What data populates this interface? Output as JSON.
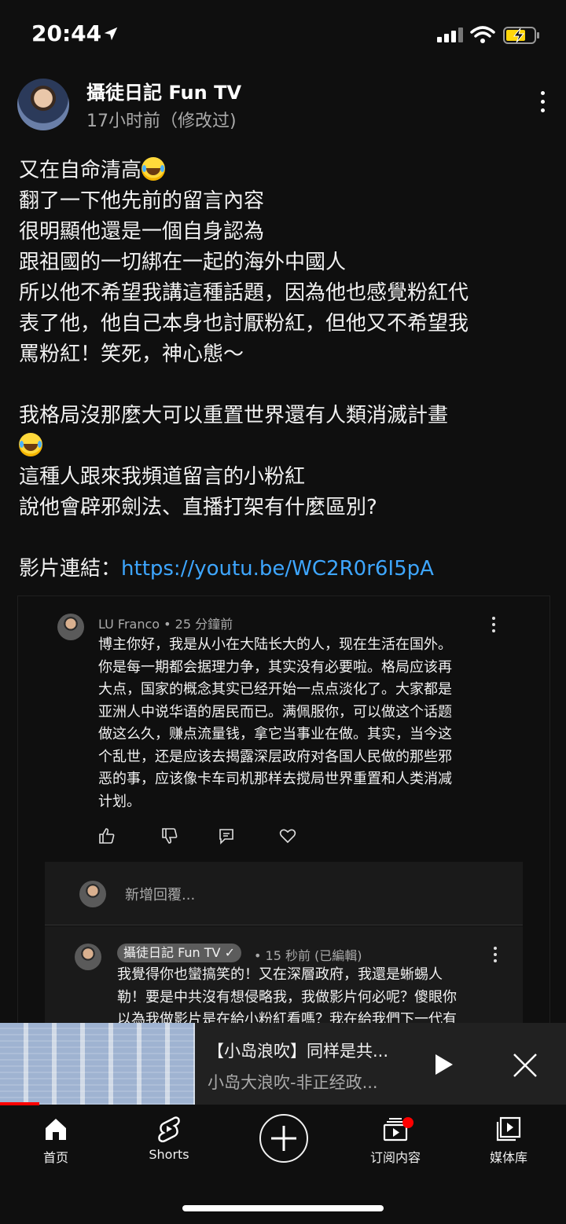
{
  "status_bar": {
    "time": "20:44"
  },
  "post": {
    "channel_name": "攝徒日記 Fun TV",
    "time": "17小时前（修改过)",
    "lines": [
      "又在自命清高",
      "翻了一下他先前的留言內容",
      "很明顯他還是一個自身認為",
      "跟祖國的一切綁在一起的海外中國人",
      "所以他不希望我講這種話題，因為他也感覺粉紅代",
      "表了他，他自己本身也討厭粉紅，但他又不希望我",
      "罵粉紅！笑死，神心態～",
      "我格局沒那麼大可以重置世界還有人類消滅計畫",
      "這種人跟來我頻道留言的小粉紅",
      "說他會辟邪劍法、直播打架有什麼區別?"
    ],
    "link_label": "影片連結：",
    "link_url": "https://youtu.be/WC2R0r6I5pA",
    "emoji_name": "tears-of-joy-emoji"
  },
  "embedded": {
    "comment1": {
      "meta": "LU Franco • 25 分鐘前",
      "lines": [
        "博主你好，我是从小在大陆长大的人，现在生活在国外。",
        "你是每一期都会据理力争，其实没有必要啦。格局应该再",
        "大点，国家的概念其实已经开始一点点淡化了。大家都是",
        "亚洲人中说华语的居民而已。满佩服你，可以做这个话题",
        "做这么久，赚点流量钱，拿它当事业在做。其实，当今这",
        "个乱世，还是应该去揭露深层政府对各国人民做的那些邪",
        "恶的事，应该像卡车司机那样去搅局世界重置和人类消减",
        "计划。"
      ]
    },
    "reply_placeholder": "新增回覆...",
    "comment2": {
      "author": "攝徒日記 Fun TV ✓",
      "meta": "• 15 秒前 (已編輯)",
      "lines": [
        "我覺得你也蠻搞笑的！又在深層政府，我還是蜥蜴人",
        "勒！要是中共沒有想侵略我，我做影片何必呢？傻眼你",
        "以為我做影片是在給小粉紅看嗎？我在給我們下一代有"
      ]
    }
  },
  "mini_player": {
    "title": "【小岛浪吹】同样是共...",
    "subtitle": "小岛大浪吹-非正经政...",
    "progress": 0.07
  },
  "nav": {
    "items": [
      {
        "label": "首页",
        "icon": "home-icon"
      },
      {
        "label": "Shorts",
        "icon": "shorts-icon"
      },
      {
        "label": "",
        "icon": "create-icon"
      },
      {
        "label": "订阅内容",
        "icon": "subscriptions-icon"
      },
      {
        "label": "媒体库",
        "icon": "library-icon"
      }
    ]
  },
  "colors": {
    "background": "#0f0f0f",
    "link": "#3ea6ff",
    "accent": "#ff0000"
  }
}
